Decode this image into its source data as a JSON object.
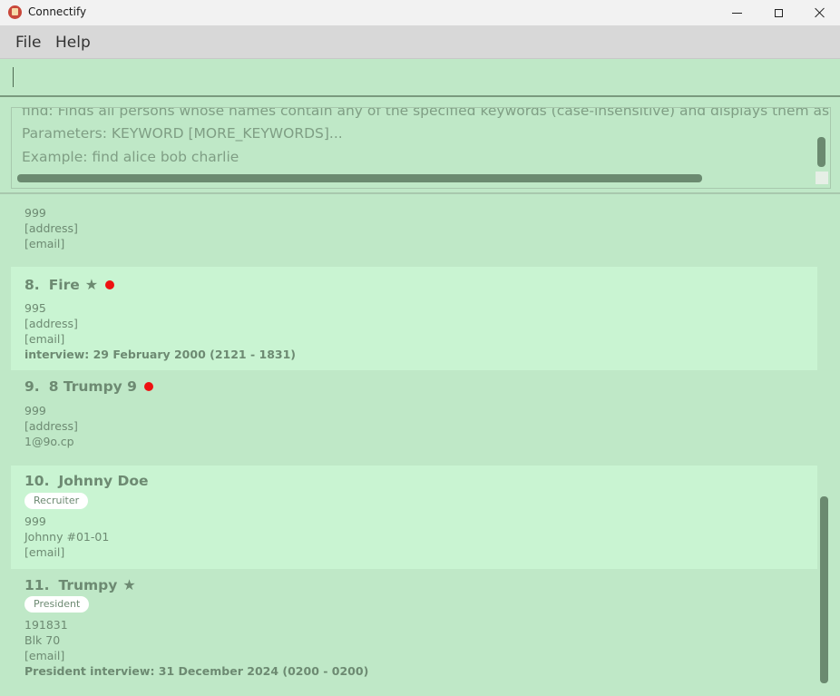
{
  "window": {
    "title": "Connectify",
    "controls": {
      "minimize_icon": "minimize-icon",
      "maximize_icon": "maximize-icon",
      "close_icon": "close-icon"
    }
  },
  "menu": {
    "items": [
      {
        "label": "File"
      },
      {
        "label": "Help"
      }
    ]
  },
  "command_box": {
    "value": "",
    "placeholder": ""
  },
  "result_display": {
    "lines": [
      "find: Finds all persons whose names contain any of the specified keywords (case-insensitive) and displays them as a list wi",
      "Parameters: KEYWORD [MORE_KEYWORDS]...",
      "Example: find alice bob charlie"
    ]
  },
  "person_list": {
    "partial_card": {
      "phone": "999",
      "address": "[address]",
      "email": "[email]"
    },
    "cards": [
      {
        "index": "8.",
        "name": "Fire",
        "starred": true,
        "flagged": true,
        "tags": [],
        "phone": "995",
        "address": "[address]",
        "email": "[email]",
        "interview": "interview: 29 February 2000 (2121 - 1831)"
      },
      {
        "index": "9.",
        "name": "8 Trumpy 9",
        "starred": false,
        "flagged": true,
        "tags": [],
        "phone": "999",
        "address": "[address]",
        "email": "1@9o.cp",
        "interview": ""
      },
      {
        "index": "10.",
        "name": "Johnny Doe",
        "starred": false,
        "flagged": false,
        "tags": [
          "Recruiter"
        ],
        "phone": "999",
        "address": "Johnny #01-01",
        "email": "[email]",
        "interview": ""
      },
      {
        "index": "11.",
        "name": "Trumpy",
        "starred": true,
        "flagged": false,
        "tags": [
          "President"
        ],
        "phone": "191831",
        "address": "Blk 70",
        "email": "[email]",
        "interview": "President interview: 31 December 2024 (0200 - 0200)"
      }
    ],
    "star_glyph": "★",
    "flag_color": "#ee1111"
  },
  "colors": {
    "background": "#bfe8c7",
    "card_alt": "#c9f4d2",
    "text": "#6d8a72",
    "scrollbar": "#6b8a70"
  }
}
